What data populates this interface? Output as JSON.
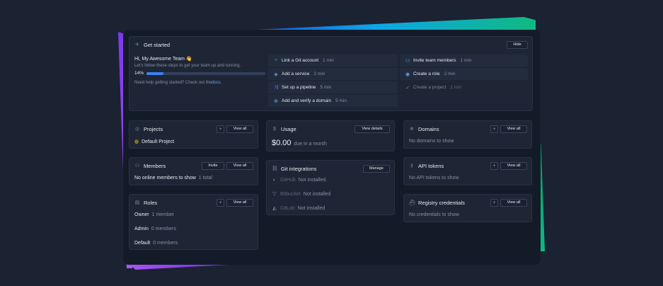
{
  "get_started": {
    "title": "Get started",
    "hide_label": "Hide",
    "greeting": "Hi, My Awesome Team 👋",
    "subtitle": "Let's follow these steps to get your team up and running.",
    "progress_label": "14%",
    "progress_value": 0.14,
    "help_prefix": "Need help getting started? Check out the ",
    "help_link": "docs",
    "help_suffix": ".",
    "tasks": [
      {
        "label": "Link a Git account",
        "duration": "1 min"
      },
      {
        "label": "Add a service",
        "duration": "2 min"
      },
      {
        "label": "Set up a pipeline",
        "duration": "5 min"
      },
      {
        "label": "Add and verify a domain",
        "duration": "5 min"
      },
      {
        "label": "Invite team members",
        "duration": "1 min"
      },
      {
        "label": "Create a role",
        "duration": "2 min"
      },
      {
        "label": "Create a project",
        "duration": "1 min"
      }
    ]
  },
  "projects": {
    "title": "Projects",
    "view_all": "View all",
    "plus": "+",
    "items": [
      "Default Project"
    ]
  },
  "members": {
    "title": "Members",
    "invite": "Invite",
    "view_all": "View all",
    "empty": "No online members to show",
    "total": "1 total"
  },
  "roles": {
    "title": "Roles",
    "view_all": "View all",
    "plus": "+",
    "items": [
      {
        "name": "Owner",
        "count": "1 member"
      },
      {
        "name": "Admin",
        "count": "0 members"
      },
      {
        "name": "Default",
        "count": "0 members"
      }
    ]
  },
  "usage": {
    "title": "Usage",
    "view_details": "View details",
    "amount": "$0.00",
    "period": "due in a month"
  },
  "git": {
    "title": "Git integrations",
    "manage": "Manage",
    "items": [
      {
        "name": "GitHub",
        "status": "Not installed"
      },
      {
        "name": "Bitbucket",
        "status": "Not installed"
      },
      {
        "name": "GitLab",
        "status": "Not installed"
      }
    ]
  },
  "domains": {
    "title": "Domains",
    "view_all": "View all",
    "plus": "+",
    "empty": "No domains to show"
  },
  "api_tokens": {
    "title": "API tokens",
    "view_all": "View all",
    "plus": "+",
    "empty": "No API tokens to show"
  },
  "registry": {
    "title": "Registry credentials",
    "view_all": "View all",
    "plus": "+",
    "empty": "No credentials to show"
  }
}
